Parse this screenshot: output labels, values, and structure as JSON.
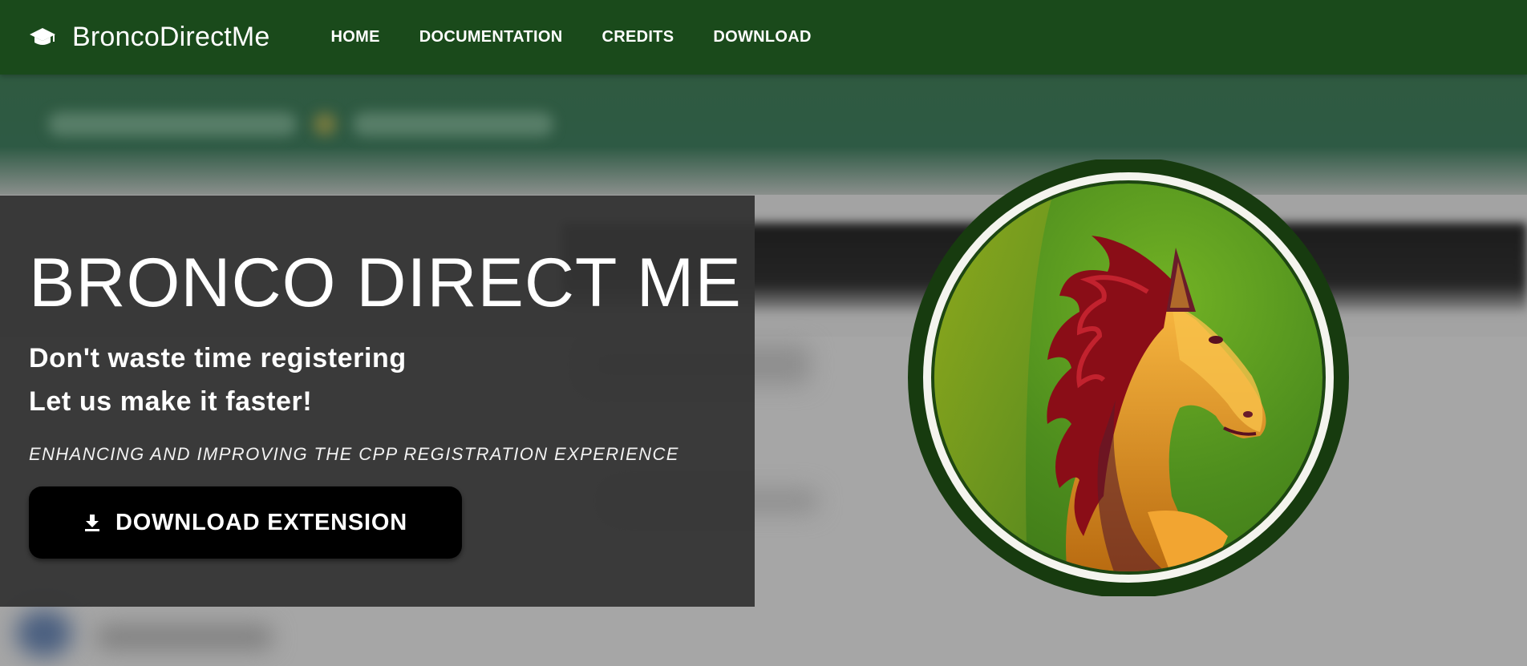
{
  "brand": {
    "name": "BroncoDirectMe",
    "icon": "graduation-cap-icon"
  },
  "nav": {
    "items": [
      {
        "label": "HOME"
      },
      {
        "label": "DOCUMENTATION"
      },
      {
        "label": "CREDITS"
      },
      {
        "label": "DOWNLOAD"
      }
    ]
  },
  "hero": {
    "title": "BRONCO DIRECT ME",
    "subtitle_line1": "Don't waste time registering",
    "subtitle_line2": "Let us make it faster!",
    "tagline": "ENHANCING AND IMPROVING THE CPP REGISTRATION EXPERIENCE",
    "download_button": {
      "label": "DOWNLOAD EXTENSION",
      "icon": "download-icon"
    }
  },
  "logo": {
    "icon": "bronco-horse-logo"
  },
  "colors": {
    "navbar": "#1a4a1b",
    "hero_panel": "#343434",
    "button": "#000000",
    "logo_ring": "#173b0f",
    "logo_green": "#5a9a24",
    "horse_gold": "#f0a530",
    "horse_mane": "#8a0d17"
  }
}
